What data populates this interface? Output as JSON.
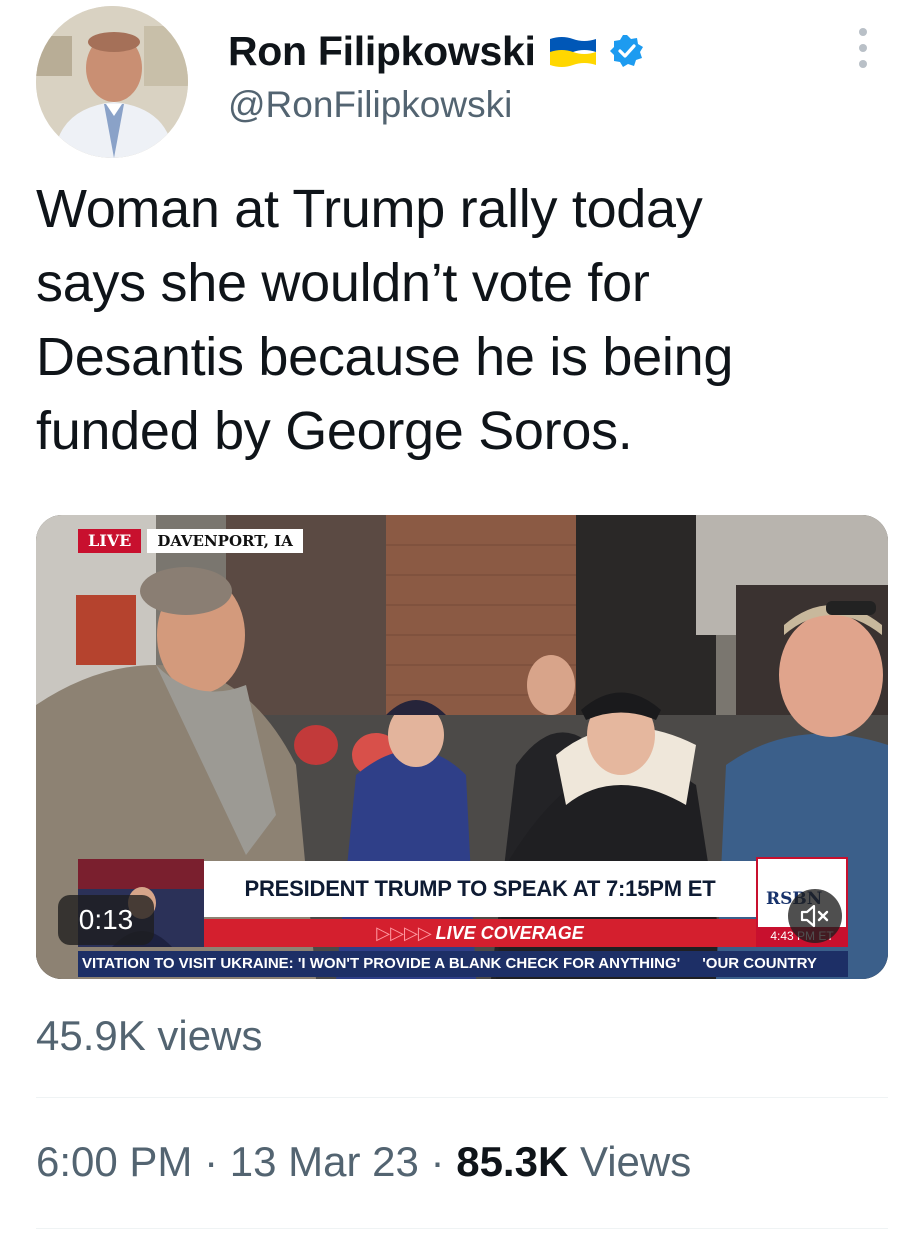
{
  "header": {
    "display_name": "Ron Filipkowski",
    "handle": "@RonFilipkowski",
    "flag_icon": "ukraine-flag-icon",
    "verified_icon": "verified-badge-icon",
    "colors": {
      "verified": "#1d9bf0",
      "flag_blue": "#0057b7",
      "flag_yellow": "#ffd700"
    }
  },
  "tweet": {
    "text": "Woman at Trump rally today\nsays she wouldn’t vote for\nDesantis because he is being\nfunded by George Soros."
  },
  "video": {
    "live_label": "LIVE",
    "location": "DAVENPORT, IA",
    "headline": "PRESIDENT TRUMP TO SPEAK AT 7:15PM ET",
    "coverage_arrows": "▷▷▷▷",
    "coverage": "LIVE COVERAGE",
    "ticker_main": "VITATION TO VISIT UKRAINE: 'I WON'T PROVIDE A BLANK CHECK FOR ANYTHING'",
    "ticker_next": "'OUR COUNTRY",
    "network_logo": "RSBN",
    "network_time": "4:43 PM ET",
    "elapsed": "0:13",
    "mute_icon": "speaker-muted-icon"
  },
  "stats": {
    "views_small": "45.9K views",
    "time": "6:00 PM",
    "separator": "·",
    "date": "13 Mar 23",
    "views_count": "85.3K",
    "views_label": "Views"
  }
}
